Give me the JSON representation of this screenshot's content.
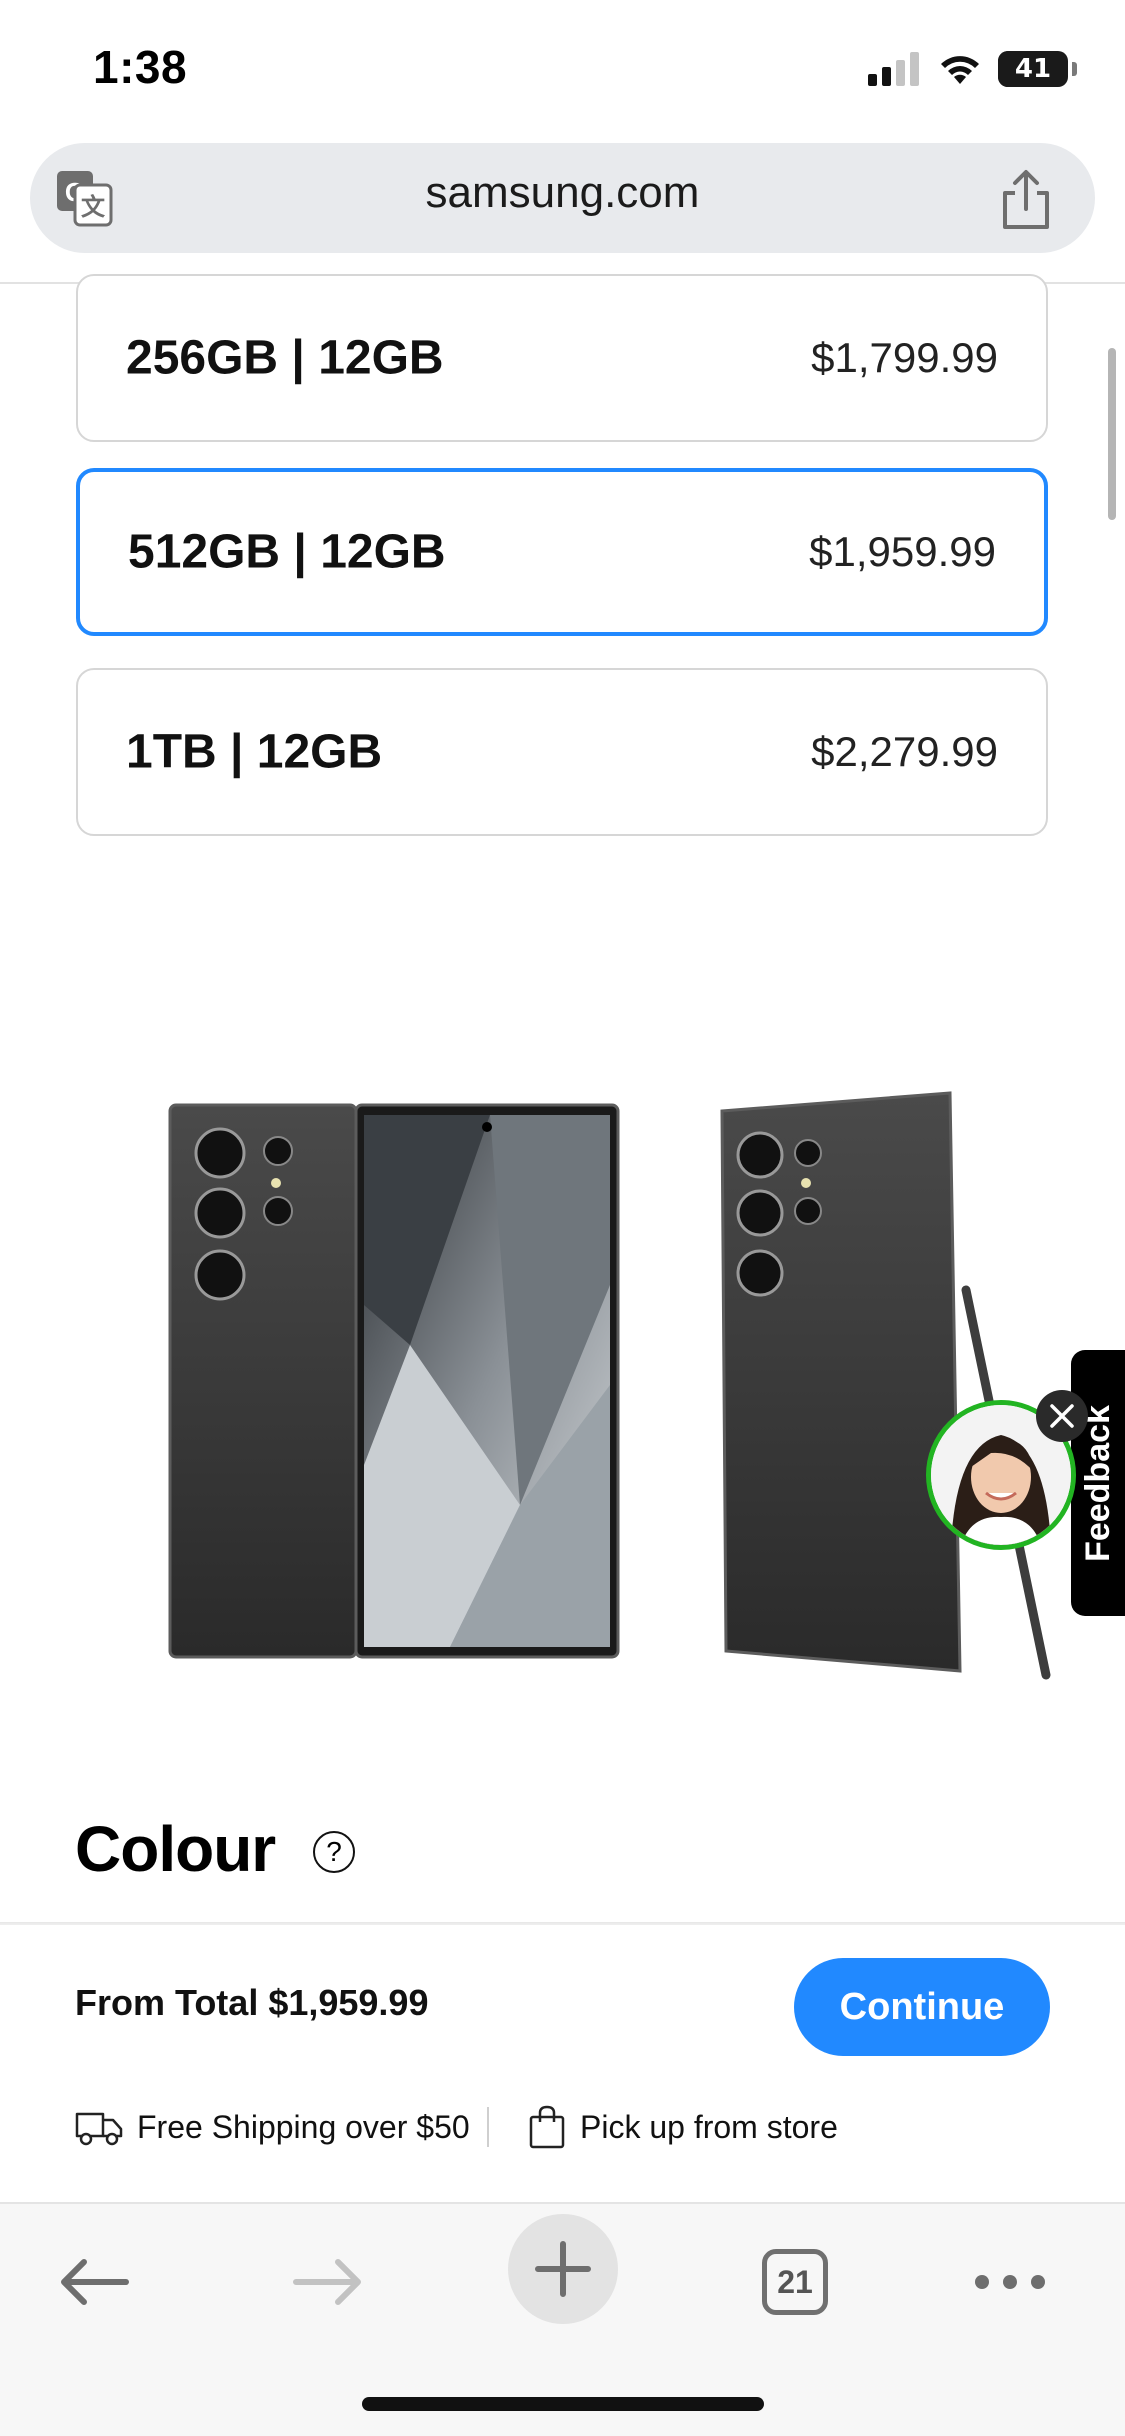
{
  "status_bar": {
    "time": "1:38",
    "battery_percent": "41",
    "battery_level": 0.41,
    "icons": [
      "signal-icon",
      "wifi-icon",
      "battery-icon"
    ]
  },
  "browser": {
    "url": "samsung.com",
    "tab_count": "21",
    "icons": [
      "translate-icon",
      "share-icon",
      "back-arrow-icon",
      "forward-arrow-icon",
      "plus-icon",
      "tabs-icon",
      "more-dots-icon"
    ]
  },
  "storage_options": [
    {
      "label": "256GB | 12GB",
      "price": "$1,799.99",
      "selected": false
    },
    {
      "label": "512GB | 12GB",
      "price": "$1,959.99",
      "selected": true
    },
    {
      "label": "1TB | 12GB",
      "price": "$2,279.99",
      "selected": false
    }
  ],
  "feedback": {
    "label": "Feedback"
  },
  "colour_section": {
    "title": "Colour",
    "help_glyph": "?"
  },
  "purchase_bar": {
    "total": "From Total $1,959.99",
    "continue_label": "Continue",
    "shipping_text": "Free Shipping over $50",
    "pickup_text": "Pick up from store"
  },
  "colors": {
    "accent": "#2189ff",
    "option_border": "#d6d6d6",
    "chat_ring": "#22b422"
  }
}
